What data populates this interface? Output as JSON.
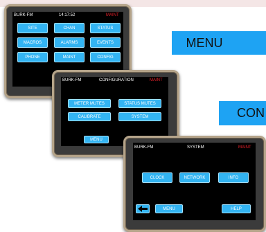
{
  "big_labels": {
    "menu": "MENU",
    "config": "CON"
  },
  "main": {
    "station": "BURK-FM",
    "time": "14:17:52",
    "status": "MAINT",
    "buttons": [
      "SITE",
      "CHAN",
      "STATUS",
      "MACROS",
      "ALARMS",
      "EVENTS",
      "PHONE",
      "MAINT",
      "CONFIG"
    ]
  },
  "config": {
    "station": "BURK-FM",
    "title": "CONFIGURATION",
    "status": "MAINT",
    "buttons": [
      "METER MUTES",
      "STATUS MUTES",
      "CALIBRATE",
      "SYSTEM"
    ],
    "menu": "MENU"
  },
  "system": {
    "station": "BURK-FM",
    "title": "SYSTEM",
    "status": "MAINT",
    "buttons": [
      "CLOCK",
      "NETWORK",
      "INFO"
    ],
    "menu": "MENU",
    "help": "HELP",
    "back_icon": "back-arrow-icon"
  },
  "colors": {
    "button": "#33b4f2",
    "status": "#e8202a",
    "big_button": "#1ea3f3"
  }
}
